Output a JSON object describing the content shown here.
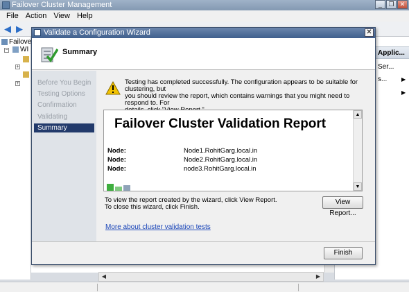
{
  "main_window": {
    "title": "Failover Cluster Management",
    "menu": [
      "File",
      "Action",
      "View",
      "Help"
    ],
    "tree": {
      "root_label": "Failove",
      "child_label": "WI"
    },
    "actions": {
      "header": "Applic...",
      "items": [
        "Ser...",
        "s..."
      ]
    }
  },
  "wizard": {
    "title": "Validate a Configuration Wizard",
    "heading": "Summary",
    "steps": [
      {
        "label": "Before You Begin",
        "active": false
      },
      {
        "label": "Testing Options",
        "active": false
      },
      {
        "label": "Confirmation",
        "active": false
      },
      {
        "label": "Validating",
        "active": false
      },
      {
        "label": "Summary",
        "active": true
      }
    ],
    "message_lines": [
      "Testing has completed successfully. The configuration appears to be suitable for clustering, but",
      "you should review the report, which contains warnings that you might need to respond to.  For",
      "details, click \"View Report.\""
    ],
    "report": {
      "title": "Failover Cluster Validation Report",
      "nodes": [
        {
          "label": "Node:",
          "value": "Node1.RohitGarg.local.in"
        },
        {
          "label": "Node:",
          "value": "Node2.RohitGarg.local.in"
        },
        {
          "label": "Node:",
          "value": "node3.RohitGarg.local.in"
        }
      ]
    },
    "hint_lines": [
      "To view the report created by the wizard, click View Report.",
      "To close this wizard, click Finish."
    ],
    "view_report_label": "View Report...",
    "link_text": "More about cluster validation tests",
    "finish_label": "Finish"
  },
  "colors": {
    "wizard_title_bg": "#3f5f8d",
    "active_step_bg": "#223a6b",
    "link": "#1a45b8",
    "warning": "#f2c200"
  },
  "icons": [
    "app-icon",
    "back-arrow-icon",
    "forward-arrow-icon",
    "cluster-icon",
    "wizard-icon",
    "summary-checklist-icon",
    "warning-icon",
    "close-icon",
    "report-thumbnail-icon"
  ]
}
